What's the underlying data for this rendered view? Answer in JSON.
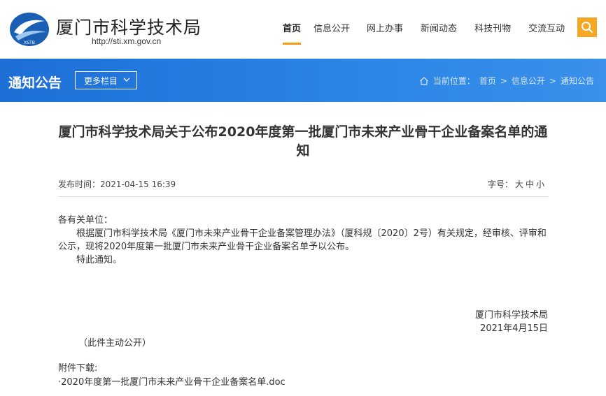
{
  "header": {
    "site_title": "厦门市科学技术局",
    "site_url": "http://sti.xm.gov.cn",
    "logo_text": "XSTB",
    "nav": [
      {
        "label": "首页",
        "active": true
      },
      {
        "label": "信息公开",
        "active": false
      },
      {
        "label": "网上办事",
        "active": false
      },
      {
        "label": "新闻动态",
        "active": false
      },
      {
        "label": "科技刊物",
        "active": false
      },
      {
        "label": "交流互动",
        "active": false
      }
    ],
    "search_icon": "search-icon",
    "accent_color": "#f5a623"
  },
  "banner": {
    "title": "通知公告",
    "more_label": "更多栏目",
    "breadcrumb_prefix": "当前位置：",
    "breadcrumbs": [
      "首页",
      "信息公开",
      "通知公告"
    ],
    "separator": ">",
    "bg_color": "#2b86e6"
  },
  "article": {
    "title": "厦门市科学技术局关于公布2020年度第一批厦门市未来产业骨干企业备案名单的通知",
    "publish_label": "发布时间：",
    "publish_time": "2021-04-15 16:39",
    "font_size_label": "字号：",
    "font_sizes": [
      "大",
      "中",
      "小"
    ],
    "salutation": "各有关单位：",
    "paragraph1": "根据厦门市科学技术局《厦门市未来产业骨干企业备案管理办法》（厦科规〔2020〕2号）有关规定，经审核、评审和公示，现将2020年度第一批厦门市未来产业骨干企业备案名单予以公布。",
    "paragraph2": "特此通知。",
    "signer": "厦门市科学技术局",
    "sign_date": "2021年4月15日",
    "public_note": "（此件主动公开）",
    "attachment_label": "附件下载:",
    "attachment_file": "·2020年度第一批厦门市未来产业骨干企业备案名单.doc"
  }
}
